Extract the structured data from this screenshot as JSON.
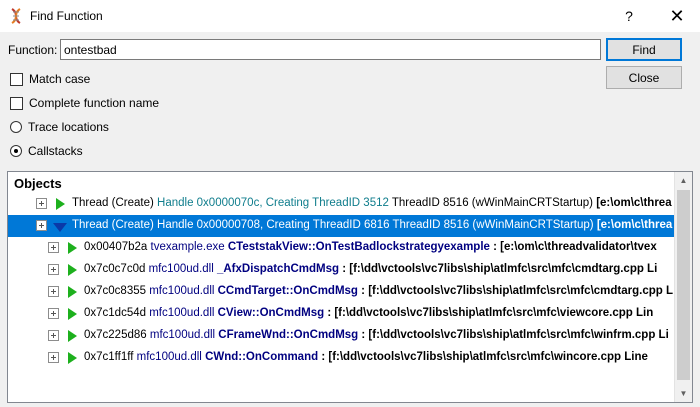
{
  "window": {
    "title": "Find Function",
    "help_glyph": "?",
    "close_glyph": "✕"
  },
  "form": {
    "function_label": "Function:",
    "function_value": "ontestbad",
    "find_label": "Find",
    "close_label": "Close",
    "match_case": {
      "label": "Match case",
      "checked": false
    },
    "complete_name": {
      "label": "Complete function name",
      "checked": false
    },
    "trace_locations": {
      "label": "Trace locations",
      "selected": false
    },
    "callstacks": {
      "label": "Callstacks",
      "selected": true
    }
  },
  "results": {
    "header": "Objects",
    "rows": [
      {
        "a": "Thread (Create) ",
        "b": "Handle 0x0000070c, Creating ThreadID 3512 ",
        "c": "ThreadID 8516 (wWinMainCRTStartup) ",
        "d": "[e:\\om\\c\\threa"
      },
      {
        "a": "Thread (Create) ",
        "b": "Handle 0x00000708, Creating ThreadID 6816 ",
        "c": "ThreadID 8516 (wWinMainCRTStartup) ",
        "d": "[e:\\om\\c\\threa"
      },
      {
        "a": "0x00407b2a ",
        "b": "tvexample.exe ",
        "c": "CTeststakView::OnTestBadlockstrategyexample",
        "d": " : [e:\\om\\c\\threadvalidator\\tvex"
      },
      {
        "a": "0x7c0c7c0d ",
        "b": "mfc100ud.dll ",
        "c": "_AfxDispatchCmdMsg",
        "d": " : [f:\\dd\\vctools\\vc7libs\\ship\\atlmfc\\src\\mfc\\cmdtarg.cpp Li"
      },
      {
        "a": "0x7c0c8355 ",
        "b": "mfc100ud.dll ",
        "c": "CCmdTarget::OnCmdMsg",
        "d": " : [f:\\dd\\vctools\\vc7libs\\ship\\atlmfc\\src\\mfc\\cmdtarg.cpp L"
      },
      {
        "a": "0x7c1dc54d ",
        "b": "mfc100ud.dll ",
        "c": "CView::OnCmdMsg",
        "d": " : [f:\\dd\\vctools\\vc7libs\\ship\\atlmfc\\src\\mfc\\viewcore.cpp Lin"
      },
      {
        "a": "0x7c225d86 ",
        "b": "mfc100ud.dll ",
        "c": "CFrameWnd::OnCmdMsg",
        "d": " : [f:\\dd\\vctools\\vc7libs\\ship\\atlmfc\\src\\mfc\\winfrm.cpp Li"
      },
      {
        "a": "0x7c1ff1ff ",
        "b": "mfc100ud.dll ",
        "c": "CWnd::OnCommand",
        "d": " : [f:\\dd\\vctools\\vc7libs\\ship\\atlmfc\\src\\mfc\\wincore.cpp Line"
      }
    ]
  }
}
